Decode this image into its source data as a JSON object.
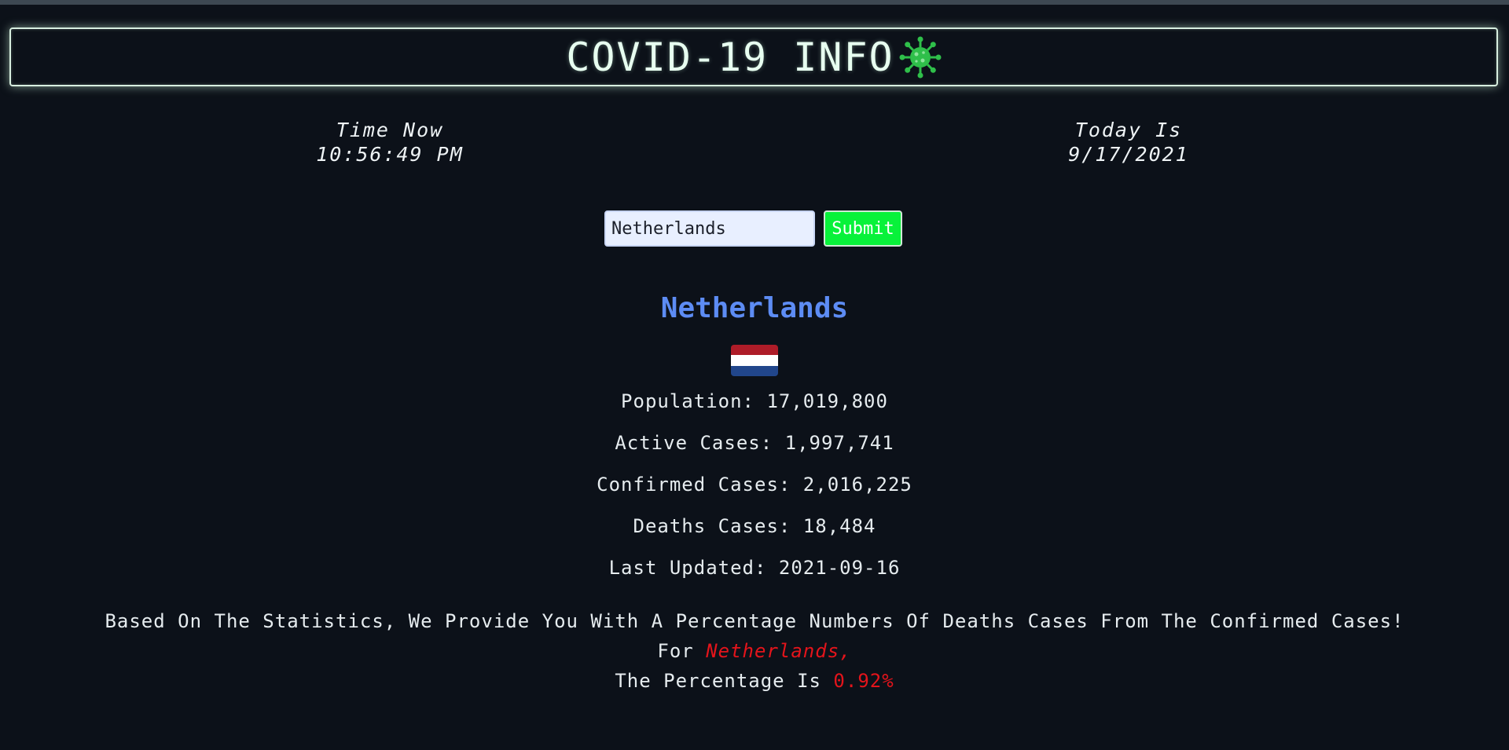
{
  "header": {
    "title": "COVID-19 INFO",
    "icon": "virus-icon"
  },
  "clock": {
    "time_label": "Time Now",
    "time_value": "10:56:49 PM",
    "date_label": "Today Is",
    "date_value": "9/17/2021"
  },
  "search": {
    "value": "Netherlands",
    "placeholder": "",
    "submit_label": "Submit"
  },
  "country": {
    "name": "Netherlands",
    "flag": {
      "icon": "netherlands-flag-icon",
      "colors": [
        "#ae1c28",
        "#ffffff",
        "#21468b"
      ]
    }
  },
  "stats": [
    {
      "label": "Population: 17,019,800"
    },
    {
      "label": "Active Cases: 1,997,741"
    },
    {
      "label": "Confirmed Cases: 2,016,225"
    },
    {
      "label": "Deaths Cases: 18,484"
    },
    {
      "label": "Last Updated: 2021-09-16"
    }
  ],
  "summary": {
    "line1": "Based On The Statistics, We Provide You With A Percentage Numbers Of Deaths Cases From The Confirmed Cases!",
    "line2_prefix": "For ",
    "line2_country": "Netherlands,",
    "line3_prefix": "The Percentage Is ",
    "line3_value": "0.92%"
  },
  "colors": {
    "background": "#0c1119",
    "accent_blue": "#5d8cf4",
    "accent_red": "#e4141b",
    "submit_green": "#08f23a"
  }
}
